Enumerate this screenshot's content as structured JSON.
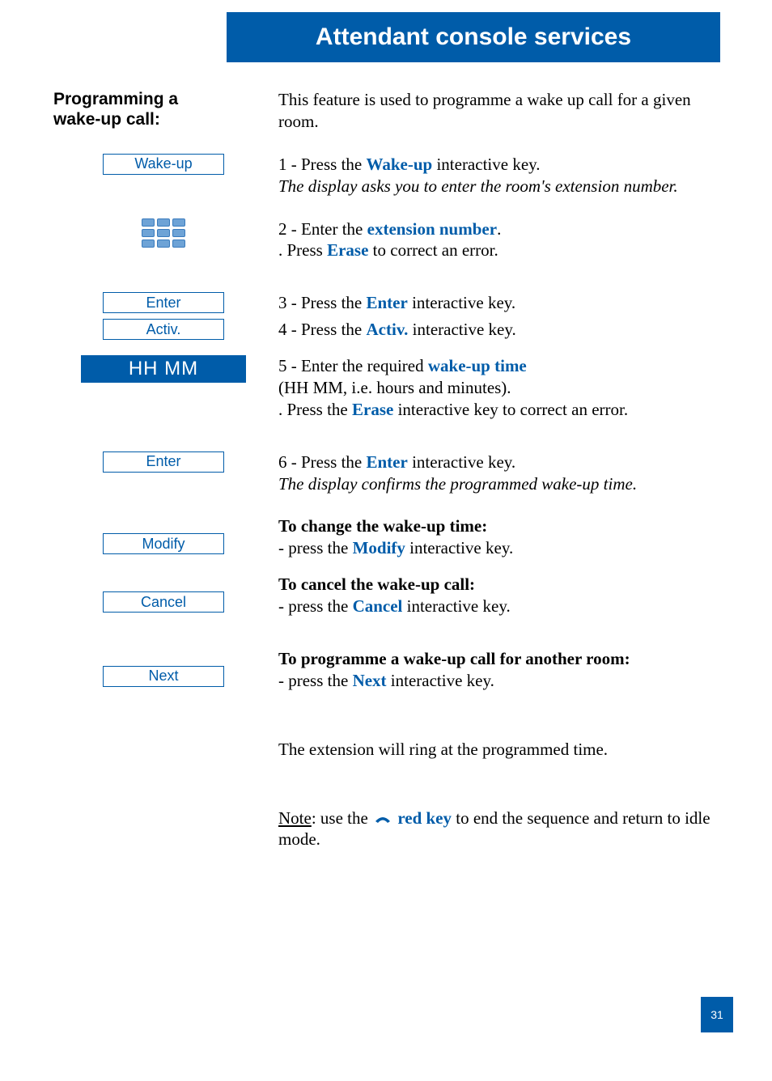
{
  "header": {
    "title": "Attendant console services"
  },
  "section_title": {
    "line1": "Programming a",
    "line2": "wake-up call:"
  },
  "intro": "This feature is used to programme a wake up call for a given room.",
  "buttons": {
    "wakeup": "Wake-up",
    "enter1": "Enter",
    "activ": "Activ.",
    "hhmm": "HH MM",
    "enter2": "Enter",
    "modify": "Modify",
    "cancel": "Cancel",
    "next": "Next"
  },
  "steps": {
    "s1": {
      "pre": "1 - Press the ",
      "key": "Wake-up",
      "post": " interactive key.",
      "sub_i": "The display asks you to enter the room's extension number."
    },
    "s2": {
      "pre": "2 - Enter the ",
      "key": "extension number",
      "post": ".",
      "sub_pre": ". Press ",
      "sub_key": "Erase",
      "sub_post": " to correct an error."
    },
    "s3": {
      "pre": "3 - Press the ",
      "key": "Enter",
      "post": " interactive key."
    },
    "s4": {
      "pre": "4 - Press the ",
      "key": "Activ.",
      "post": " interactive key."
    },
    "s5": {
      "pre": "5 - Enter the required ",
      "key": "wake-up time",
      "sub1": "(HH MM, i.e. hours and minutes).",
      "sub2_pre": ". Press the ",
      "sub2_key": "Erase",
      "sub2_post": " interactive key to correct an error."
    },
    "s6": {
      "pre": "6 - Press the ",
      "key": "Enter",
      "post": " interactive key.",
      "sub_i": "The display confirms the programmed wake-up time."
    }
  },
  "change": {
    "title": "To change the wake-up time:",
    "line_pre": "- press the ",
    "line_key": "Modify",
    "line_post": " interactive key."
  },
  "cancel": {
    "title": "To cancel the wake-up call:",
    "line_pre": "- press the ",
    "line_key": "Cancel",
    "line_post": " interactive key."
  },
  "another": {
    "title": "To programme a wake-up call for another room:",
    "line_pre": "- press the ",
    "line_key": "Next",
    "line_post": " interactive key."
  },
  "conclusion": "The extension will ring at the programmed time.",
  "note": {
    "label": "Note",
    "pre": ": use the ",
    "key": " red key",
    "post": " to end the sequence and return to idle mode."
  },
  "page_number": "31"
}
